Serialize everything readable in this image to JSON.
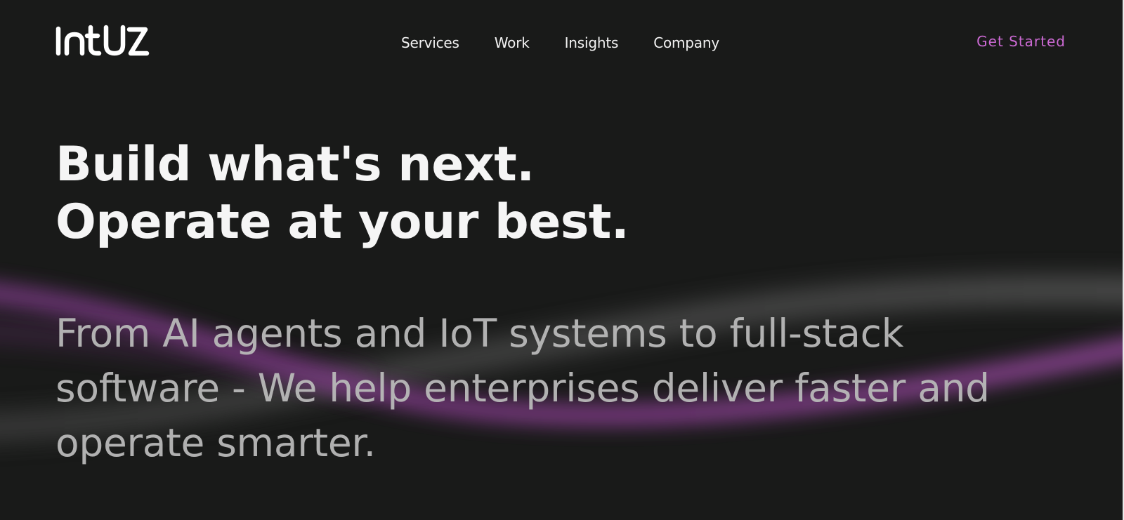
{
  "brand": {
    "logo_text": "intuz",
    "logo_color": "#ffffff"
  },
  "nav": {
    "items": [
      {
        "label": "Services"
      },
      {
        "label": "Work"
      },
      {
        "label": "Insights"
      },
      {
        "label": "Company"
      }
    ],
    "cta_label": "Get Started",
    "cta_color": "#cc6ad4"
  },
  "hero": {
    "headline_line1": "Build what's next.",
    "headline_line2": "Operate at your best.",
    "subheadline": "From AI agents and IoT systems to full-stack software - We help enterprises deliver faster and operate smarter."
  },
  "colors": {
    "background": "#191a19",
    "headline": "#f5f5f5",
    "subheadline": "#b9b9b9",
    "wave_purple": "#8a3f92",
    "wave_grey": "#5a5a5a"
  }
}
